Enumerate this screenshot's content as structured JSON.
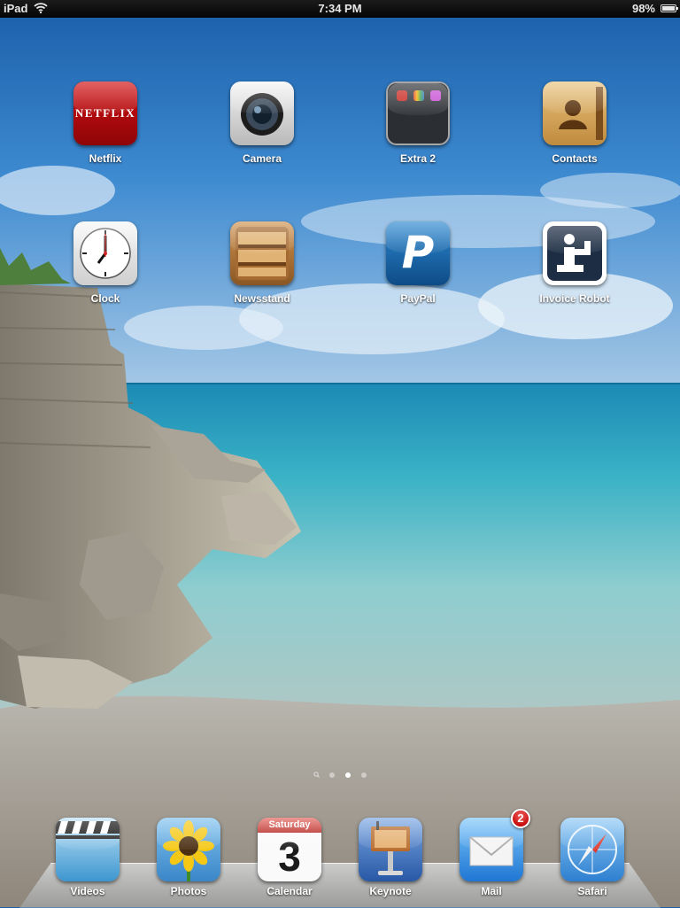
{
  "status_bar": {
    "device": "iPad",
    "time": "7:34 PM",
    "battery": "98%",
    "battery_level": 0.98
  },
  "home": {
    "apps": [
      {
        "label": "Netflix",
        "icon": "netflix-icon",
        "logo_text": "NETFLIX"
      },
      {
        "label": "Camera",
        "icon": "camera-icon"
      },
      {
        "label": "Extra 2",
        "icon": "folder-icon"
      },
      {
        "label": "Contacts",
        "icon": "contacts-icon"
      },
      {
        "label": "Clock",
        "icon": "clock-icon"
      },
      {
        "label": "Newsstand",
        "icon": "newsstand-icon"
      },
      {
        "label": "PayPal",
        "icon": "paypal-icon",
        "logo_text": "P"
      },
      {
        "label": "Invoice Robot",
        "icon": "invoice-robot-icon"
      }
    ]
  },
  "page_indicator": {
    "pages": 3,
    "current": 2,
    "has_search_page": true
  },
  "dock": {
    "apps": [
      {
        "label": "Videos",
        "icon": "videos-icon"
      },
      {
        "label": "Photos",
        "icon": "photos-icon"
      },
      {
        "label": "Calendar",
        "icon": "calendar-icon",
        "weekday": "Saturday",
        "day": "3"
      },
      {
        "label": "Keynote",
        "icon": "keynote-icon"
      },
      {
        "label": "Mail",
        "icon": "mail-icon",
        "badge": "2"
      },
      {
        "label": "Safari",
        "icon": "safari-icon"
      }
    ]
  },
  "colors": {
    "badge": "#c80e0e",
    "status_bar": "#0b0b0b"
  }
}
